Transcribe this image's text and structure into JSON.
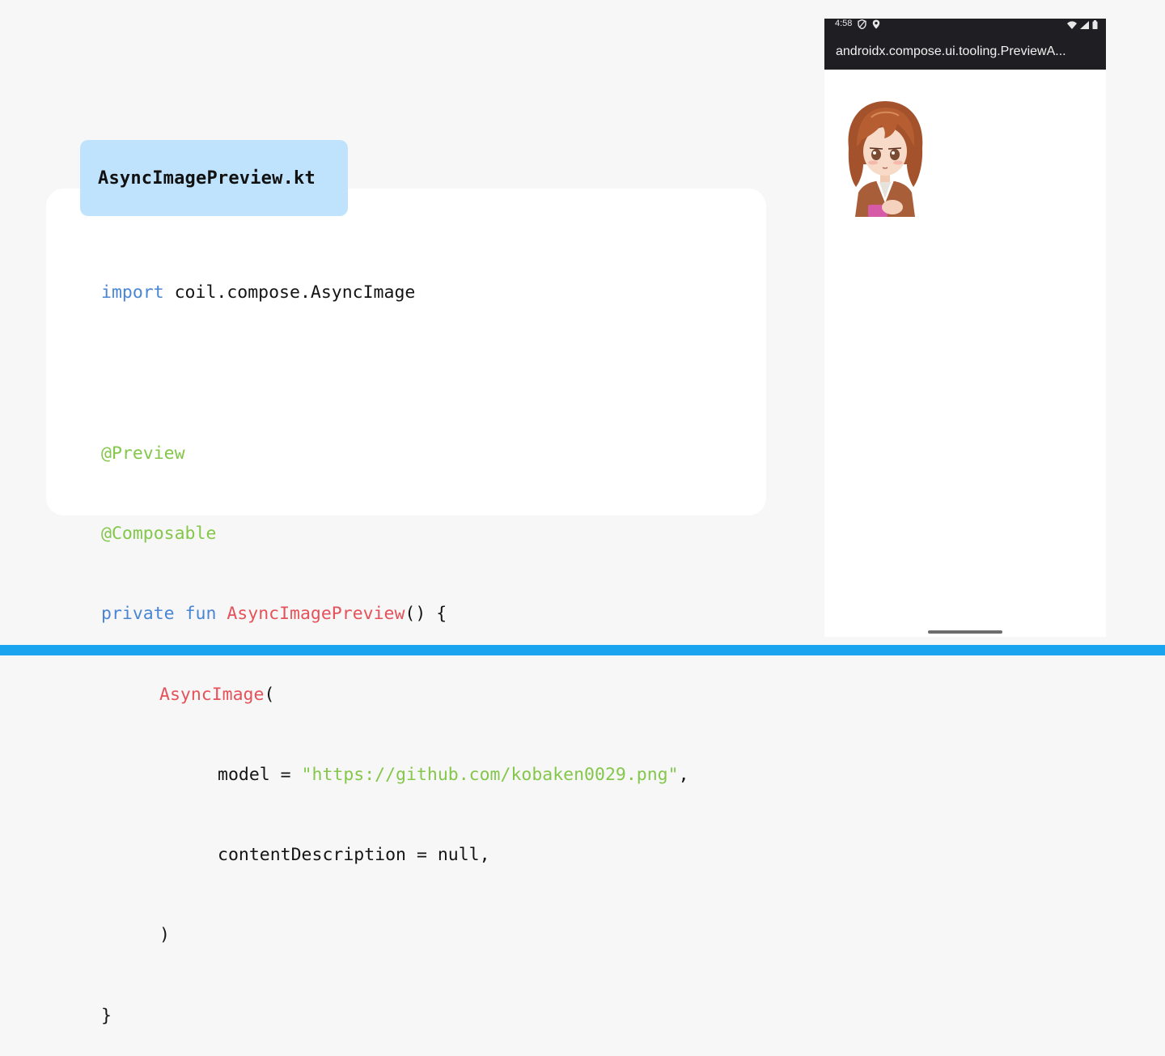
{
  "slide": {
    "file_name": "AsyncImagePreview.kt",
    "colors": {
      "background": "#f7f7f7",
      "keyword": "#4a86d4",
      "annotation": "#84c74b",
      "function": "#e5525a",
      "string": "#84c74b",
      "tab": "#bfe3fc",
      "bottom_bar": "#1aa3ef"
    },
    "code": {
      "l1_kw": "import",
      "l1_rest": " coil.compose.AsyncImage",
      "l3": "@Preview",
      "l4": "@Composable",
      "l5_kw1": "private",
      "l5_kw2": "fun",
      "l5_fn": "AsyncImagePreview",
      "l5_rest": "() {",
      "l6_fn": "AsyncImage",
      "l6_rest": "(",
      "l7_pre": "model = ",
      "l7_str": "\"https://github.com/kobaken0029.png\"",
      "l7_post": ",",
      "l8": "contentDescription = null,",
      "l9": ")",
      "l10": "}"
    }
  },
  "phone": {
    "status_time": "4:58",
    "status_left_icons": [
      "vpn-shield-icon",
      "location-icon"
    ],
    "status_right_icons": [
      "wifi-icon",
      "signal-icon",
      "battery-icon"
    ],
    "app_title": "androidx.compose.ui.tooling.PreviewA...",
    "image": "anime-girl-avatar"
  }
}
